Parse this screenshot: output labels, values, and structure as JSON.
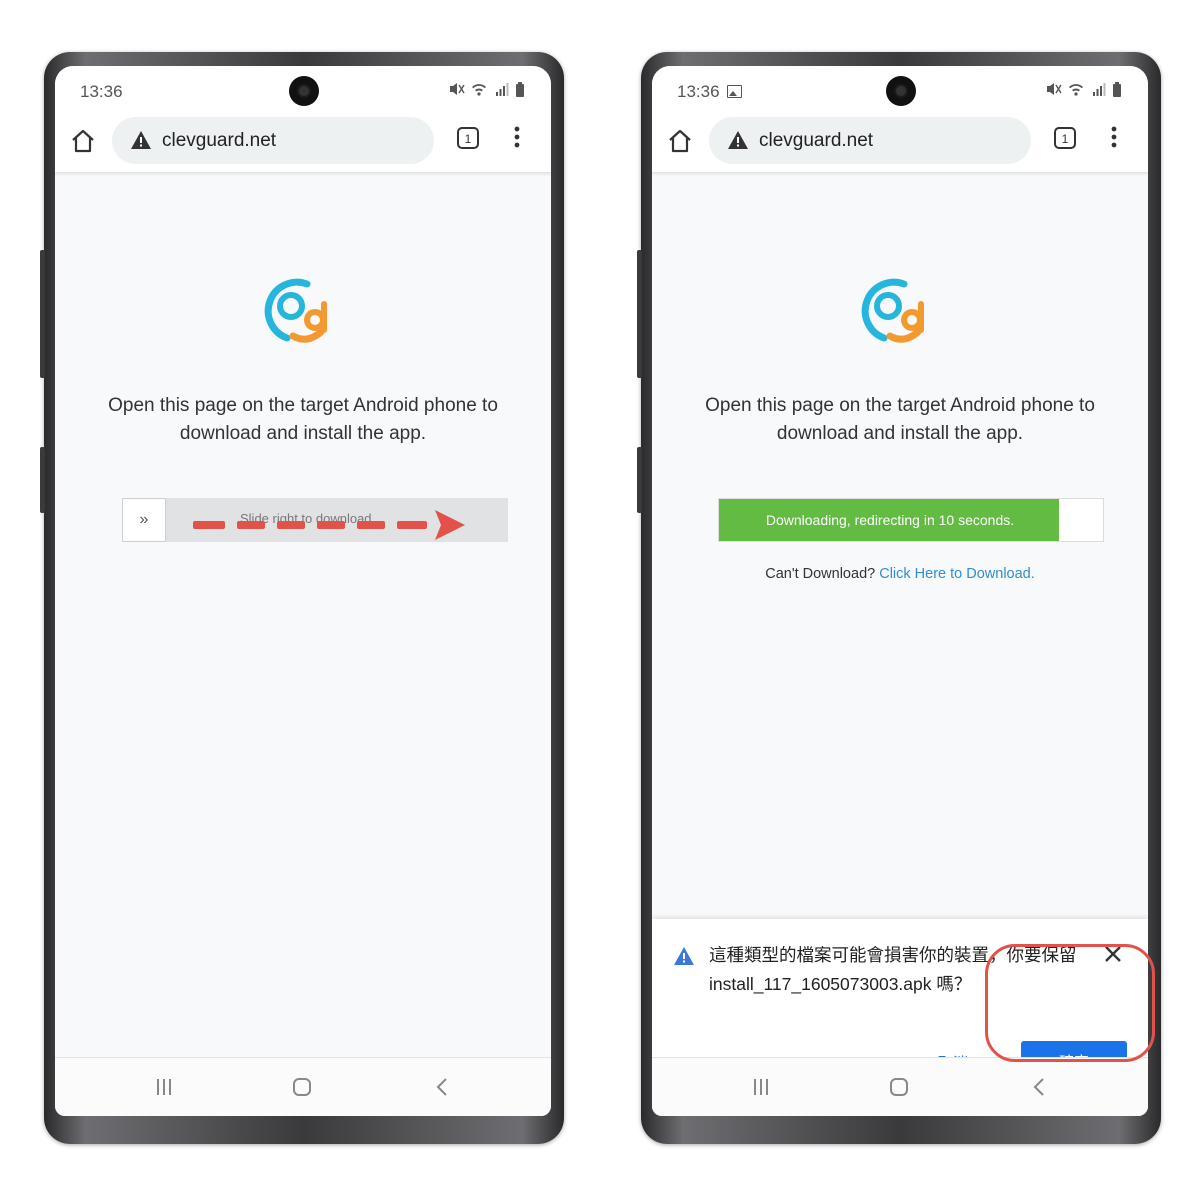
{
  "left_phone": {
    "status_time": "13:36",
    "url": "clevguard.net",
    "tab_count": "1",
    "instruction_line1": "Open this page on the target Android phone to",
    "instruction_line2": "download and install the app.",
    "slider_handle": "»",
    "slider_text": "Slide right to download"
  },
  "right_phone": {
    "status_time": "13:36",
    "url": "clevguard.net",
    "tab_count": "1",
    "instruction_line1": "Open this page on the target Android phone to",
    "instruction_line2": "download and install the app.",
    "progress_text": "Downloading, redirecting in 10 seconds.",
    "progress_fraction": 0.886,
    "cant_download": "Can't Download?",
    "click_here": "Click Here to Download.",
    "dialog_message": "這種類型的檔案可能會損害你的裝置，你要保留 install_117_1605073003.apk 嗎？",
    "dialog_cancel": "取消",
    "dialog_ok": "確定"
  },
  "colors": {
    "progress_green": "#63bb43",
    "accent_blue": "#1a73e8",
    "link_blue": "#2f8ed3",
    "annotation_red": "#e2524a"
  },
  "icons": [
    "home-icon",
    "warning-icon",
    "tabs-icon",
    "more-vert-icon",
    "recent-apps-icon",
    "nav-home-icon",
    "back-icon",
    "close-icon",
    "gallery-icon",
    "app-logo"
  ]
}
